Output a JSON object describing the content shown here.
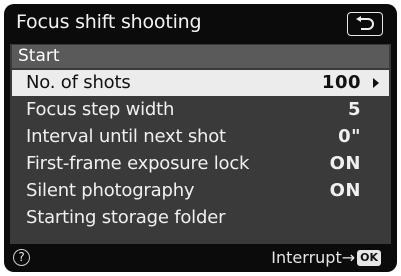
{
  "header": {
    "title": "Focus shift shooting",
    "back_icon": "return-arrow-icon"
  },
  "menu": {
    "start_label": "Start",
    "items": [
      {
        "label": "No. of shots",
        "value": "100",
        "selected": true,
        "has_arrow": true
      },
      {
        "label": "Focus step width",
        "value": "5",
        "selected": false
      },
      {
        "label": "Interval until next shot",
        "value": "0\"",
        "selected": false
      },
      {
        "label": "First-frame exposure lock",
        "value": "ON",
        "selected": false
      },
      {
        "label": "Silent photography",
        "value": "ON",
        "selected": false
      },
      {
        "label": "Starting storage folder",
        "value": "",
        "selected": false
      }
    ]
  },
  "footer": {
    "help_icon": "?",
    "interrupt_label": "Interrupt",
    "interrupt_arrow": "→",
    "ok_label": "OK"
  },
  "colors": {
    "screen_bg": "#0b0b0b",
    "panel_bg": "#3a3a3a",
    "start_bg": "#5a5a5a",
    "selected_bg": "#ececec"
  }
}
